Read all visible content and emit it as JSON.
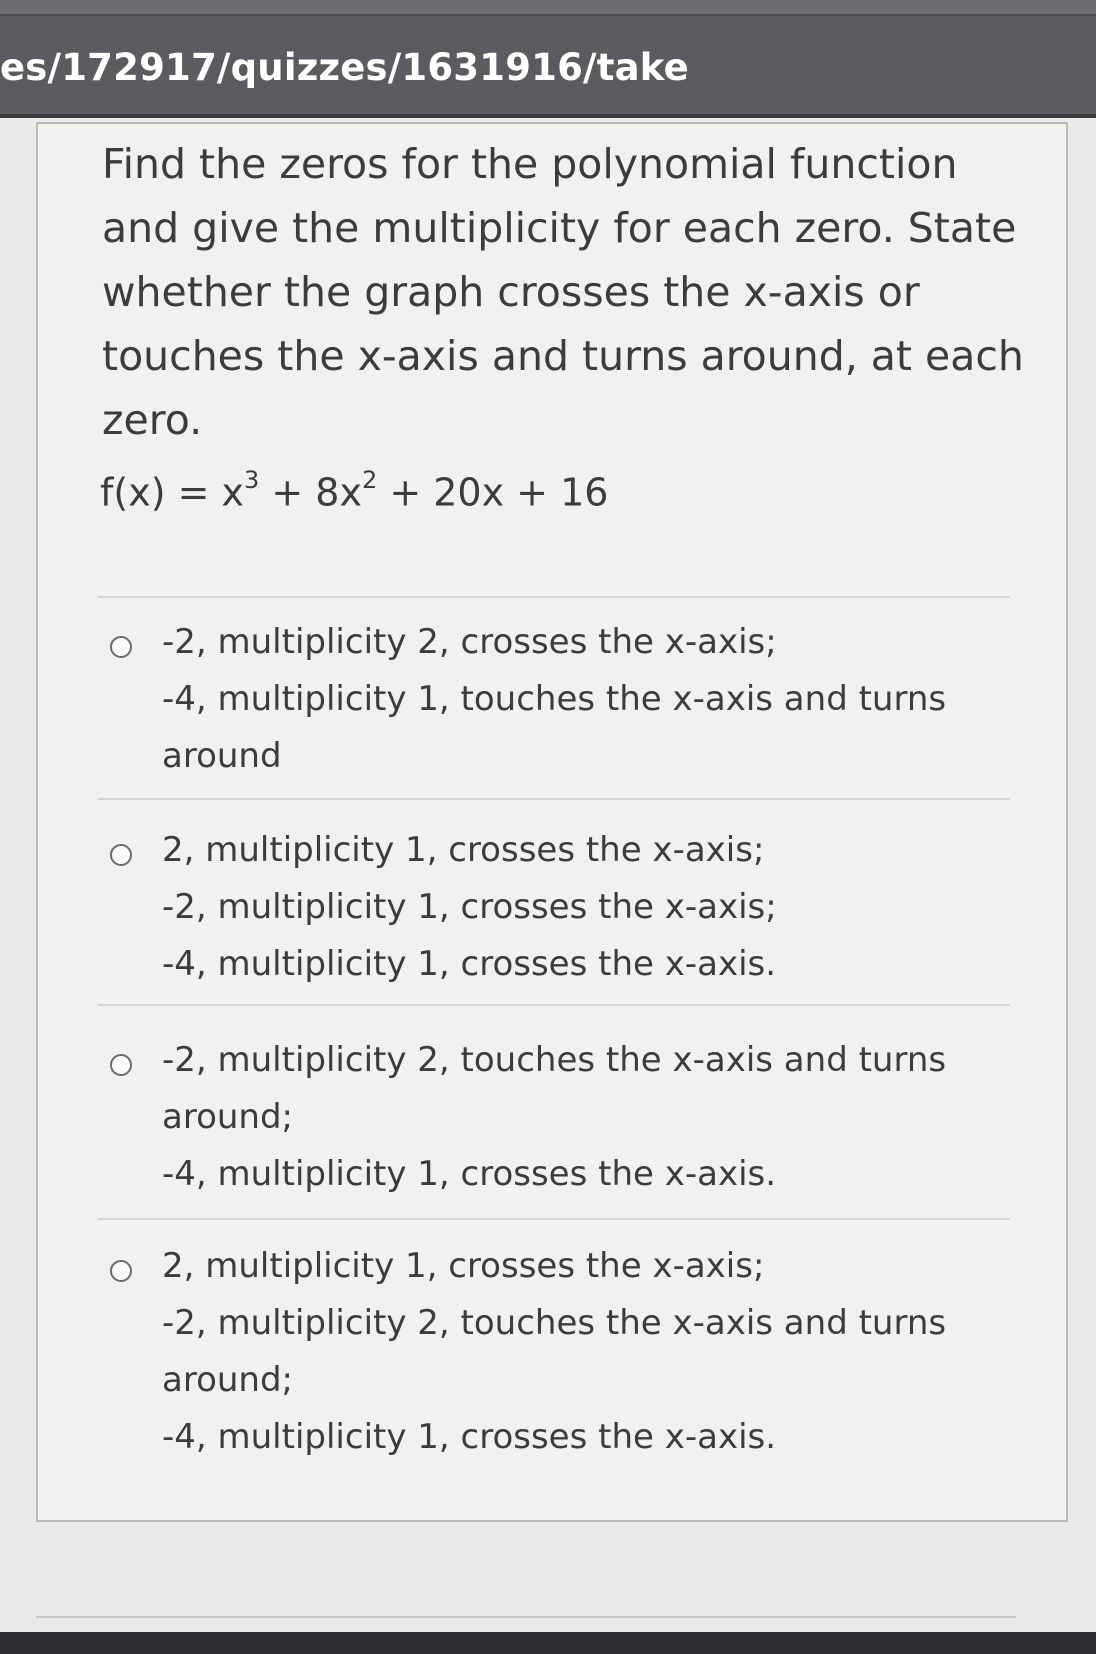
{
  "browser": {
    "url": "es/172917/quizzes/1631916/take"
  },
  "question": {
    "text": "Find the zeros for the polynomial function and give the multiplicity for each zero. State whether the graph crosses the x-axis or touches the x-axis and turns around, at each zero.",
    "formula_prefix": "f(x) = x",
    "exp1": "3",
    "formula_mid": " + 8x",
    "exp2": "2",
    "formula_suffix": " + 20x + 16"
  },
  "options": [
    {
      "lines": [
        "-2, multiplicity 2, crosses the x-axis;",
        "-4, multiplicity 1, touches the x-axis and turns",
        "around"
      ]
    },
    {
      "lines": [
        "2, multiplicity 1, crosses the x-axis;",
        "-2, multiplicity 1, crosses the x-axis;",
        "-4, multiplicity 1, crosses the x-axis."
      ]
    },
    {
      "lines": [
        "-2, multiplicity 2, touches the x-axis and turns",
        "around;",
        "-4, multiplicity 1, crosses the x-axis."
      ]
    },
    {
      "lines": [
        "2, multiplicity 1, crosses the x-axis;",
        "-2, multiplicity 2, touches the x-axis and turns",
        "around;",
        "-4, multiplicity 1, crosses the x-axis."
      ]
    }
  ]
}
